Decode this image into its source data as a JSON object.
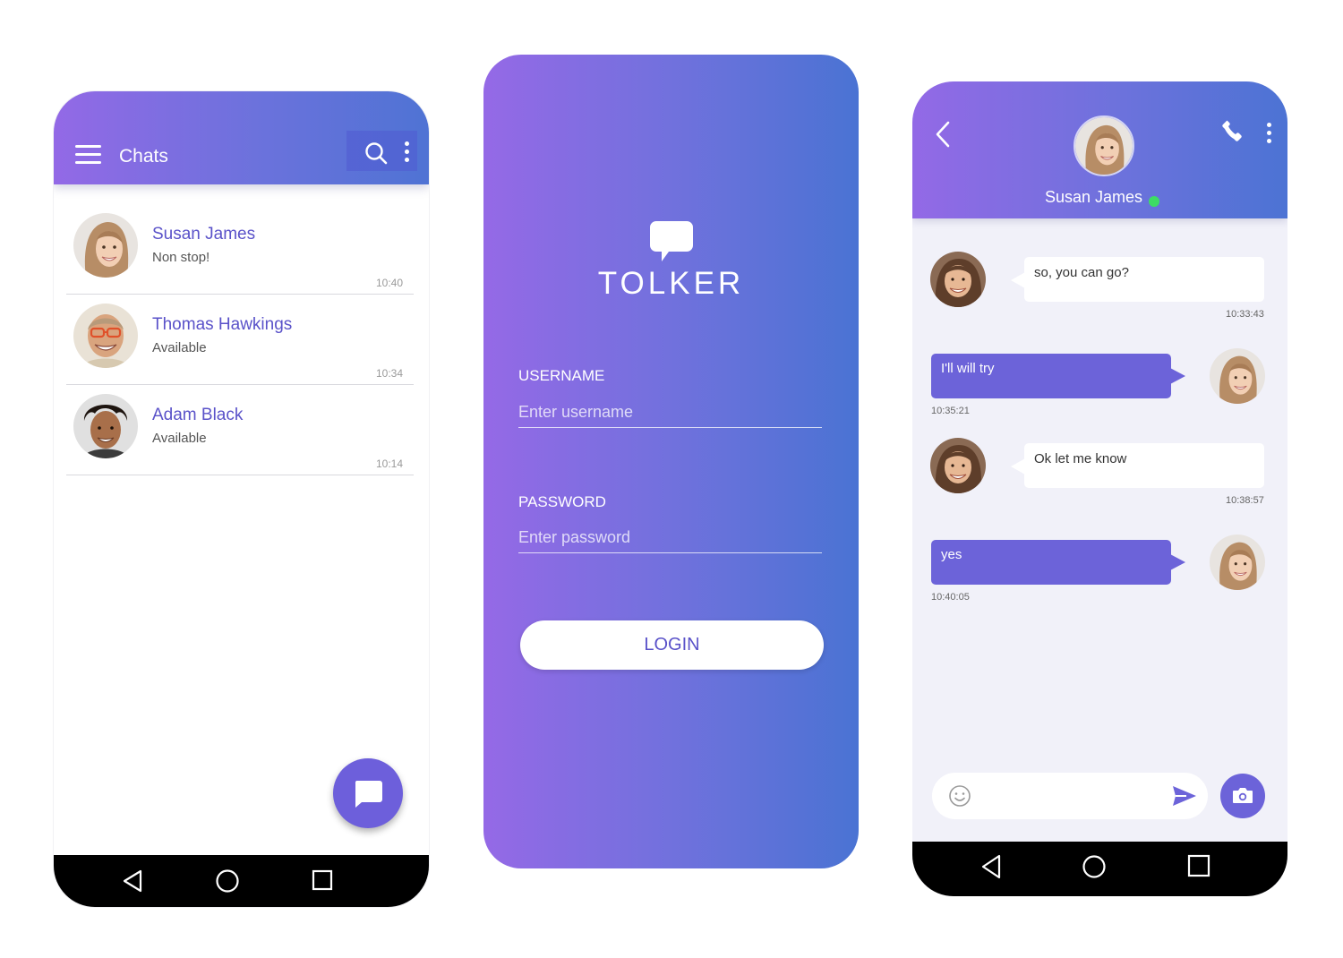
{
  "colors": {
    "accent": "#6c63d9",
    "gradient_start": "#9369e6",
    "gradient_end": "#4a73d3",
    "online": "#3ddc65"
  },
  "chats_screen": {
    "title": "Chats",
    "icons": [
      "menu-icon",
      "search-icon",
      "more-vert-icon",
      "chat-bubble-icon"
    ],
    "chats": [
      {
        "name": "Susan James",
        "status": "Non stop!",
        "time": "10:40"
      },
      {
        "name": "Thomas Hawkings",
        "status": "Available",
        "time": "10:34"
      },
      {
        "name": "Adam Black",
        "status": "Available",
        "time": "10:14"
      }
    ]
  },
  "login_screen": {
    "brand": "TOLKER",
    "username_label": "USERNAME",
    "username_placeholder": "Enter username",
    "password_label": "PASSWORD",
    "password_placeholder": "Enter password",
    "login_label": "LOGIN"
  },
  "conversation_screen": {
    "contact_name": "Susan James",
    "contact_online": true,
    "messages": [
      {
        "direction": "incoming",
        "text": "so, you can go?",
        "time": "10:33:43"
      },
      {
        "direction": "outgoing",
        "text": "I'll will try",
        "time": "10:35:21"
      },
      {
        "direction": "incoming",
        "text": "Ok let me know",
        "time": "10:38:57"
      },
      {
        "direction": "outgoing",
        "text": "yes",
        "time": "10:40:05"
      }
    ],
    "icons": [
      "back-arrow-icon",
      "phone-icon",
      "more-vert-icon",
      "emoji-icon",
      "send-icon",
      "camera-icon"
    ]
  },
  "system_nav": [
    "back",
    "home",
    "recents"
  ]
}
